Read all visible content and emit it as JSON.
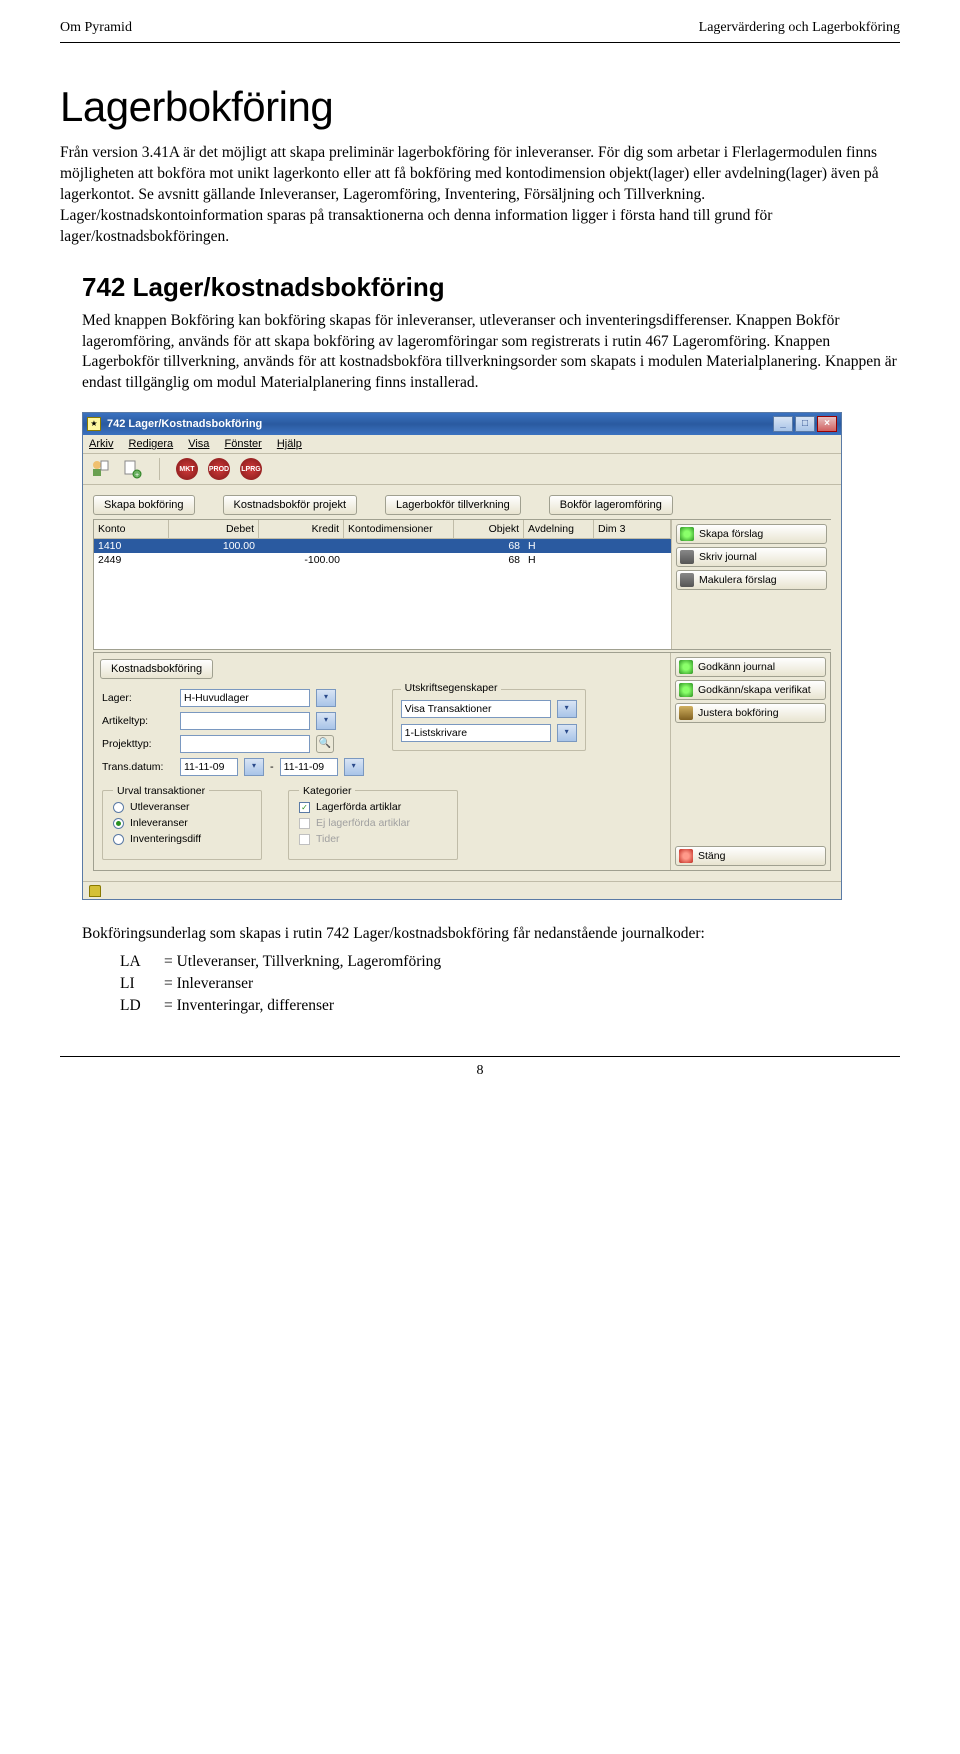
{
  "header": {
    "left": "Om Pyramid",
    "right": "Lagervärdering och Lagerbokföring"
  },
  "title": "Lagerbokföring",
  "intro": "Från version 3.41A är det möjligt att skapa preliminär lagerbokföring för inleveranser. För dig som arbetar i Flerlagermodulen finns möjligheten att bokföra mot unikt lagerkonto eller att få bokföring med kontodimension objekt(lager) eller avdelning(lager) även på lagerkontot. Se avsnitt gällande Inleveranser, Lageromföring, Inventering, Försäljning och Tillverkning. Lager/kostnadskontoinformation sparas på transaktionerna och denna information ligger i första hand till grund för lager/kostnadsbokföringen.",
  "subhead": "742 Lager/kostnadsbokföring",
  "subpara": "Med knappen Bokföring kan bokföring skapas för inleveranser, utleveranser och inventeringsdifferenser. Knappen Bokför lageromföring, används för att skapa bokföring av lageromföringar som registrerats i rutin 467 Lageromföring. Knappen Lagerbokför tillverkning, används för att kostnadsbokföra tillverkningsorder som skapats i modulen Materialplanering. Knappen är endast tillgänglig om modul Materialplanering finns installerad.",
  "window": {
    "title": "742 Lager/Kostnadsbokföring",
    "menus": [
      "Arkiv",
      "Redigera",
      "Visa",
      "Fönster",
      "Hjälp"
    ],
    "roundButtons": [
      "MKT",
      "PROD",
      "LPRG"
    ],
    "tabs": [
      "Skapa bokföring",
      "Kostnadsbokför projekt",
      "Lagerbokför tillverkning",
      "Bokför lageromföring"
    ],
    "gridHeaders": {
      "konto": "Konto",
      "debet": "Debet",
      "kredit": "Kredit",
      "kd": "Kontodimensioner",
      "obj": "Objekt",
      "avd": "Avdelning",
      "dim": "Dim 3"
    },
    "rows": [
      {
        "konto": "1410",
        "debet": "100.00",
        "kredit": "",
        "kd": "",
        "obj": "68",
        "avd": "H",
        "dim": ""
      },
      {
        "konto": "2449",
        "debet": "",
        "kredit": "-100.00",
        "kd": "",
        "obj": "68",
        "avd": "H",
        "dim": ""
      }
    ],
    "sideTop": [
      {
        "icon": "chk-green",
        "label": "Skapa förslag"
      },
      {
        "icon": "chk-print",
        "label": "Skriv journal"
      },
      {
        "icon": "chk-print",
        "label": "Makulera förslag"
      }
    ],
    "lowerTab": "Kostnadsbokföring",
    "form": {
      "lagerLabel": "Lager:",
      "lager": "H-Huvudlager",
      "artikeltypLabel": "Artikeltyp:",
      "artikeltyp": "",
      "projekttypLabel": "Projekttyp:",
      "projekttyp": "",
      "transLabel": "Trans.datum:",
      "trans1": "11-11-09",
      "trans2": "11-11-09",
      "utskriftLabel": "Utskriftsegenskaper",
      "visaLabel": "Visa Transaktioner",
      "printer": "1-Listskrivare"
    },
    "urvalTitle": "Urval transaktioner",
    "urval": [
      {
        "label": "Utleveranser",
        "on": false
      },
      {
        "label": "Inleveranser",
        "on": true
      },
      {
        "label": "Inventeringsdiff",
        "on": false
      }
    ],
    "katTitle": "Kategorier",
    "kat": [
      {
        "label": "Lagerförda artiklar",
        "on": true,
        "disabled": false
      },
      {
        "label": "Ej lagerförda artiklar",
        "on": false,
        "disabled": true
      },
      {
        "label": "Tider",
        "on": false,
        "disabled": true
      }
    ],
    "sideBottom": [
      {
        "icon": "chk-green",
        "label": "Godkänn journal"
      },
      {
        "icon": "chk-green",
        "label": "Godkänn/skapa verifikat"
      },
      {
        "icon": "chk-pen",
        "label": "Justera bokföring"
      }
    ],
    "closeBtn": "Stäng"
  },
  "footer": "Bokföringsunderlag som skapas i rutin 742 Lager/kostnadsbokföring får nedanstående journalkoder:",
  "codes": [
    {
      "c": "LA",
      "d": "= Utleveranser, Tillverkning, Lageromföring"
    },
    {
      "c": "LI",
      "d": "= Inleveranser"
    },
    {
      "c": "LD",
      "d": "= Inventeringar, differenser"
    }
  ],
  "pageNum": "8"
}
